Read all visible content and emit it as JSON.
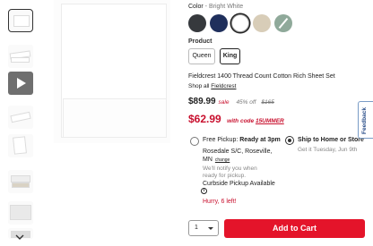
{
  "color": {
    "label": "Color",
    "separator": " - ",
    "value": "Bright White"
  },
  "swatches": [
    {
      "name": "Black",
      "hex": "#36393d"
    },
    {
      "name": "Navy",
      "hex": "#1f2f5c"
    },
    {
      "name": "Bright White",
      "hex": "#ffffff",
      "selected": true
    },
    {
      "name": "Linen",
      "hex": "#d8cdb8"
    },
    {
      "name": "Sage Stripe",
      "hex": "#8fa99a"
    }
  ],
  "product": {
    "label": "Product",
    "options": [
      {
        "label": "Queen",
        "selected": false
      },
      {
        "label": "King",
        "selected": true
      }
    ]
  },
  "title": "Fieldcrest 1400 Thread Count Cotton Rich Sheet Set",
  "shop_all": {
    "prefix": "Shop all ",
    "link": "Fieldcrest"
  },
  "pricing": {
    "price": "$89.99",
    "sale_label": "sale",
    "off_label": "45% off",
    "original": "$165",
    "code_price": "$62.99",
    "code_prefix": "with code",
    "code": "15UMMER"
  },
  "pickup": {
    "free_pickup_label": "Free Pickup:",
    "ready_text": "Ready at 3pm",
    "store_line1": "Rosedale S/C, Roseville,",
    "store_line2": "MN",
    "change": "change",
    "notify_line1": "We'll notify you when",
    "notify_line2": "ready for pickup.",
    "curbside": "Curbside Pickup Available",
    "hurry": "Hurry, 6 left!"
  },
  "ship": {
    "label": "Ship to Home or Store",
    "eta": "Get it Tuesday, Jun 9th",
    "selected": true
  },
  "quantity": "1",
  "add_to_cart": "Add to Cart",
  "feedback": "Feedback"
}
